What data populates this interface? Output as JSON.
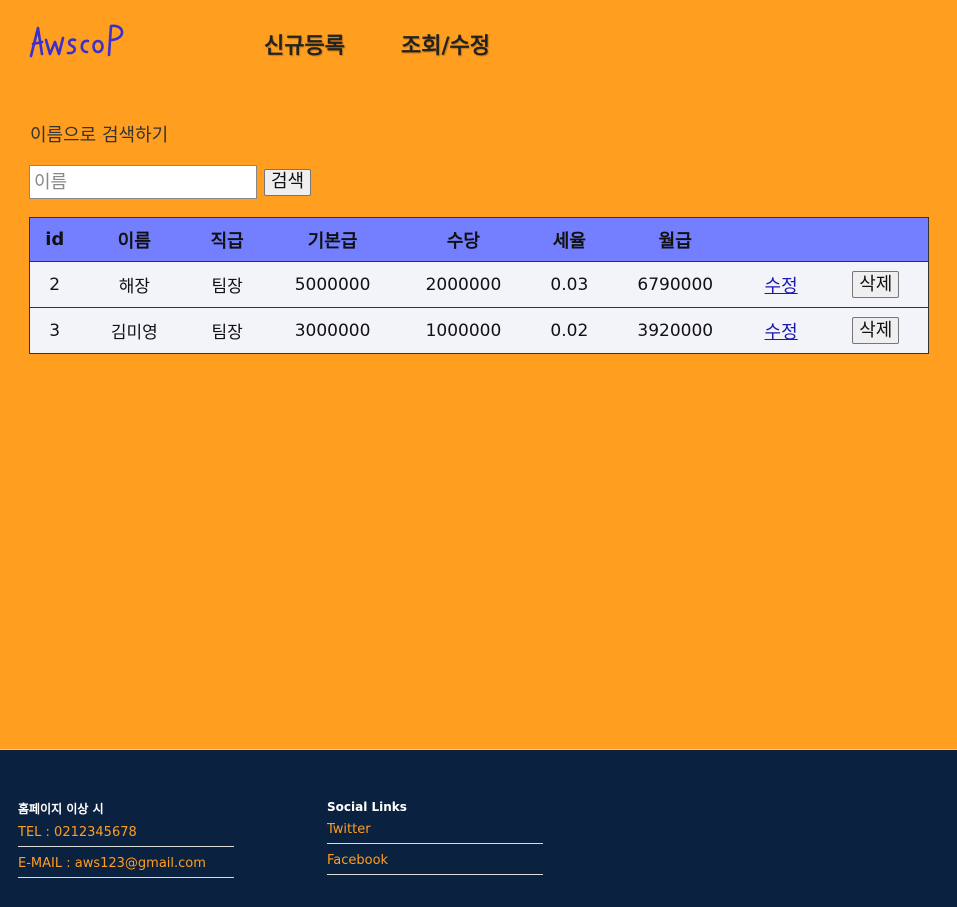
{
  "header": {
    "logo_text": "AwscoP",
    "nav": [
      {
        "label": "신규등록"
      },
      {
        "label": "조회/수정"
      }
    ]
  },
  "search": {
    "title": "이름으로 검색하기",
    "placeholder": "이름",
    "value": "",
    "button_label": "검색"
  },
  "table": {
    "headers": [
      "id",
      "이름",
      "직급",
      "기본급",
      "수당",
      "세율",
      "월급",
      "",
      ""
    ],
    "rows": [
      {
        "id": "2",
        "name": "해장",
        "rank": "팀장",
        "base": "5000000",
        "allowance": "2000000",
        "tax": "0.03",
        "salary": "6790000",
        "edit": "수정",
        "delete": "삭제"
      },
      {
        "id": "3",
        "name": "김미영",
        "rank": "팀장",
        "base": "3000000",
        "allowance": "1000000",
        "tax": "0.02",
        "salary": "3920000",
        "edit": "수정",
        "delete": "삭제"
      }
    ]
  },
  "footer": {
    "col1": {
      "title": "홈페이지 이상 시",
      "items": [
        "TEL : 0212345678",
        "E-MAIL : aws123@gmail.com"
      ]
    },
    "col2": {
      "title": "Social Links",
      "items": [
        "Twitter",
        "Facebook"
      ]
    }
  },
  "colors": {
    "background": "#FF9E1F",
    "table_header": "#737FFF",
    "footer": "#0B2140",
    "accent": "#FF9E1F"
  }
}
